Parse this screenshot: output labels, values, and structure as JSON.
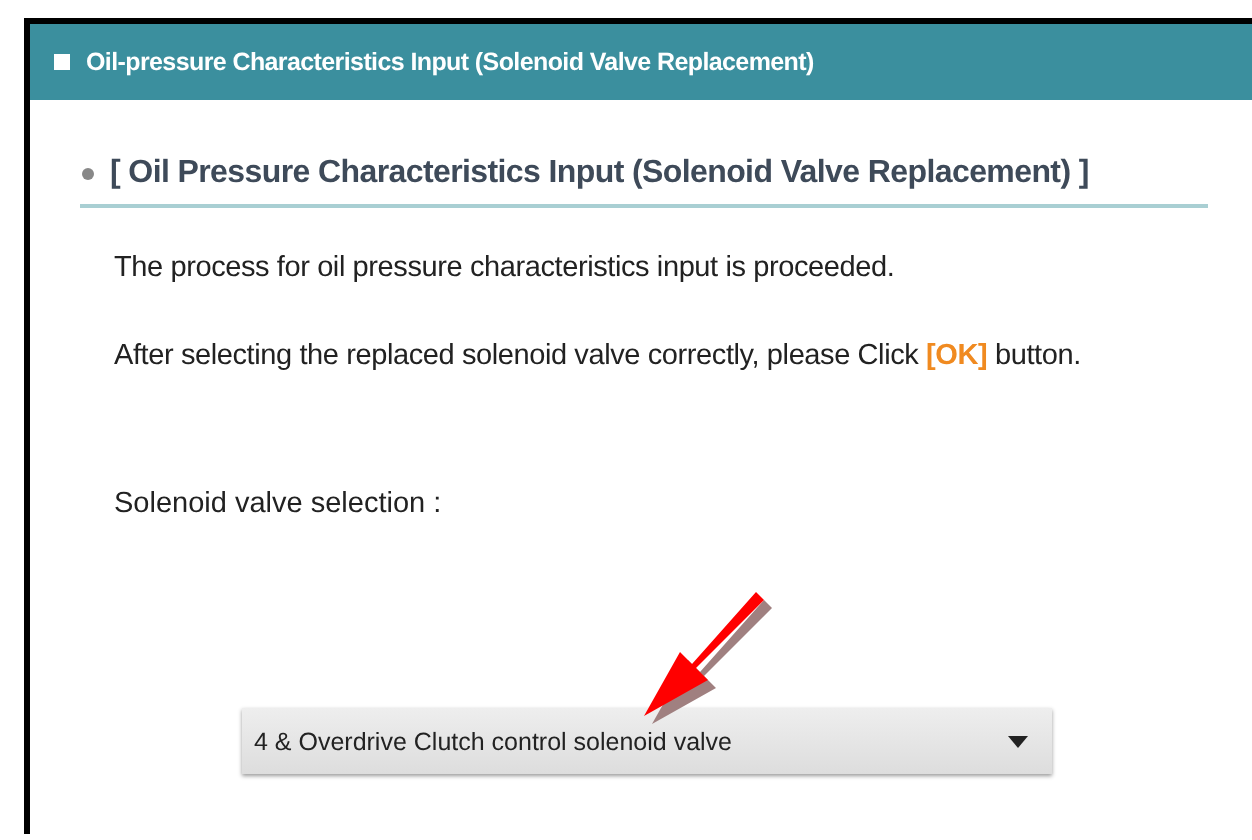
{
  "window": {
    "title": "Oil-pressure Characteristics Input (Solenoid Valve Replacement)"
  },
  "section": {
    "heading": "[ Oil Pressure Characteristics Input (Solenoid Valve Replacement) ]"
  },
  "paragraphs": [
    "The process for oil pressure characteristics input is proceeded.",
    "After selecting the replaced solenoid valve correctly, please Click **[OK]** button."
  ],
  "selection": {
    "label": "Solenoid valve selection :",
    "value": "4 & Overdrive Clutch control solenoid valve"
  }
}
